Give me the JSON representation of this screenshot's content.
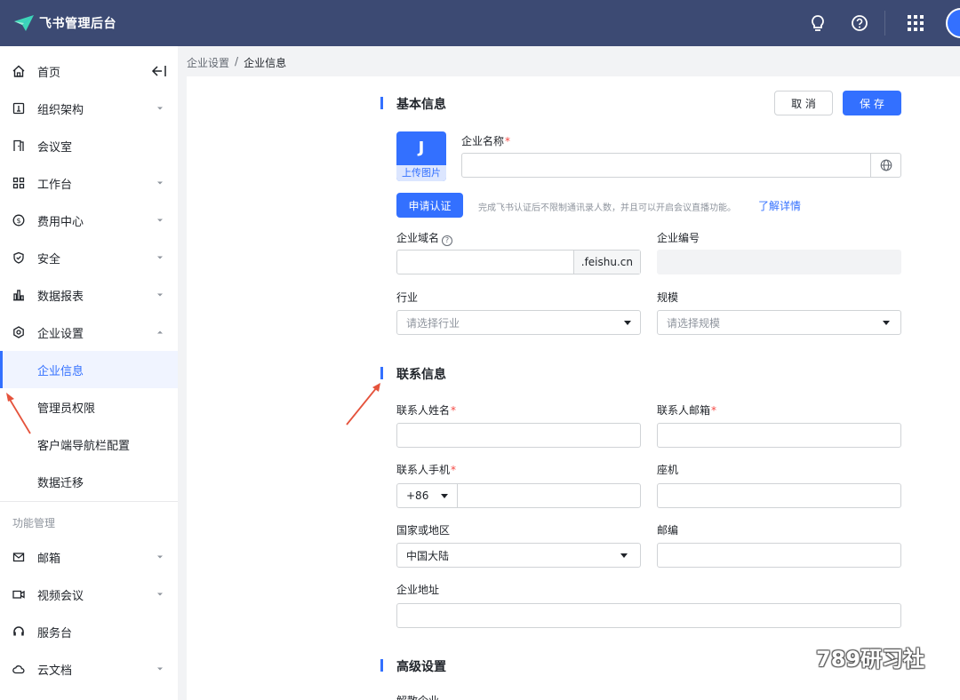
{
  "header": {
    "title": "飞书管理后台",
    "colors": {
      "bar": "#3c4a73",
      "accent": "#3370ff"
    }
  },
  "sidebar": {
    "collapse_icon": "collapse-left-icon",
    "items": [
      {
        "label": "首页",
        "icon": "home-icon"
      },
      {
        "label": "组织架构",
        "icon": "org-icon"
      },
      {
        "label": "会议室",
        "icon": "door-icon"
      },
      {
        "label": "工作台",
        "icon": "apps-icon"
      },
      {
        "label": "费用中心",
        "icon": "coin-icon"
      },
      {
        "label": "安全",
        "icon": "shield-icon"
      },
      {
        "label": "数据报表",
        "icon": "bar-chart-icon"
      },
      {
        "label": "企业设置",
        "icon": "settings-icon"
      }
    ],
    "sub_items": [
      {
        "label": "企业信息",
        "active": true
      },
      {
        "label": "管理员权限"
      },
      {
        "label": "客户端导航栏配置"
      },
      {
        "label": "数据迁移"
      }
    ],
    "section_title": "功能管理",
    "feature_items": [
      {
        "label": "邮箱",
        "icon": "mail-icon"
      },
      {
        "label": "视频会议",
        "icon": "video-icon"
      },
      {
        "label": "服务台",
        "icon": "headset-icon"
      },
      {
        "label": "云文档",
        "icon": "cloud-icon"
      }
    ]
  },
  "breadcrumb": {
    "parent": "企业设置",
    "separator": "/",
    "current": "企业信息"
  },
  "basic": {
    "title": "基本信息",
    "cancel": "取 消",
    "save": "保 存",
    "avatar_letter": "J",
    "upload_label": "上传图片",
    "company_name_label": "企业名称",
    "required_mark": "*",
    "certify_button": "申请认证",
    "certify_hint": "完成飞书认证后不限制通讯录人数，并且可以开启会议直播功能。",
    "learn_more": "了解详情",
    "domain_label": "企业域名",
    "domain_suffix": ".feishu.cn",
    "company_id_label": "企业编号",
    "industry_label": "行业",
    "industry_placeholder": "请选择行业",
    "scale_label": "规模",
    "scale_placeholder": "请选择规模"
  },
  "contact": {
    "title": "联系信息",
    "name_label": "联系人姓名",
    "email_label": "联系人邮箱",
    "phone_label": "联系人手机",
    "phone_code": "+86",
    "landline_label": "座机",
    "country_label": "国家或地区",
    "country_value": "中国大陆",
    "postcode_label": "邮编",
    "address_label": "企业地址"
  },
  "advanced": {
    "title": "高级设置",
    "first_item": "解散企业"
  },
  "watermark": {
    "text": "789研习社",
    "icon": "wechat-icon"
  }
}
